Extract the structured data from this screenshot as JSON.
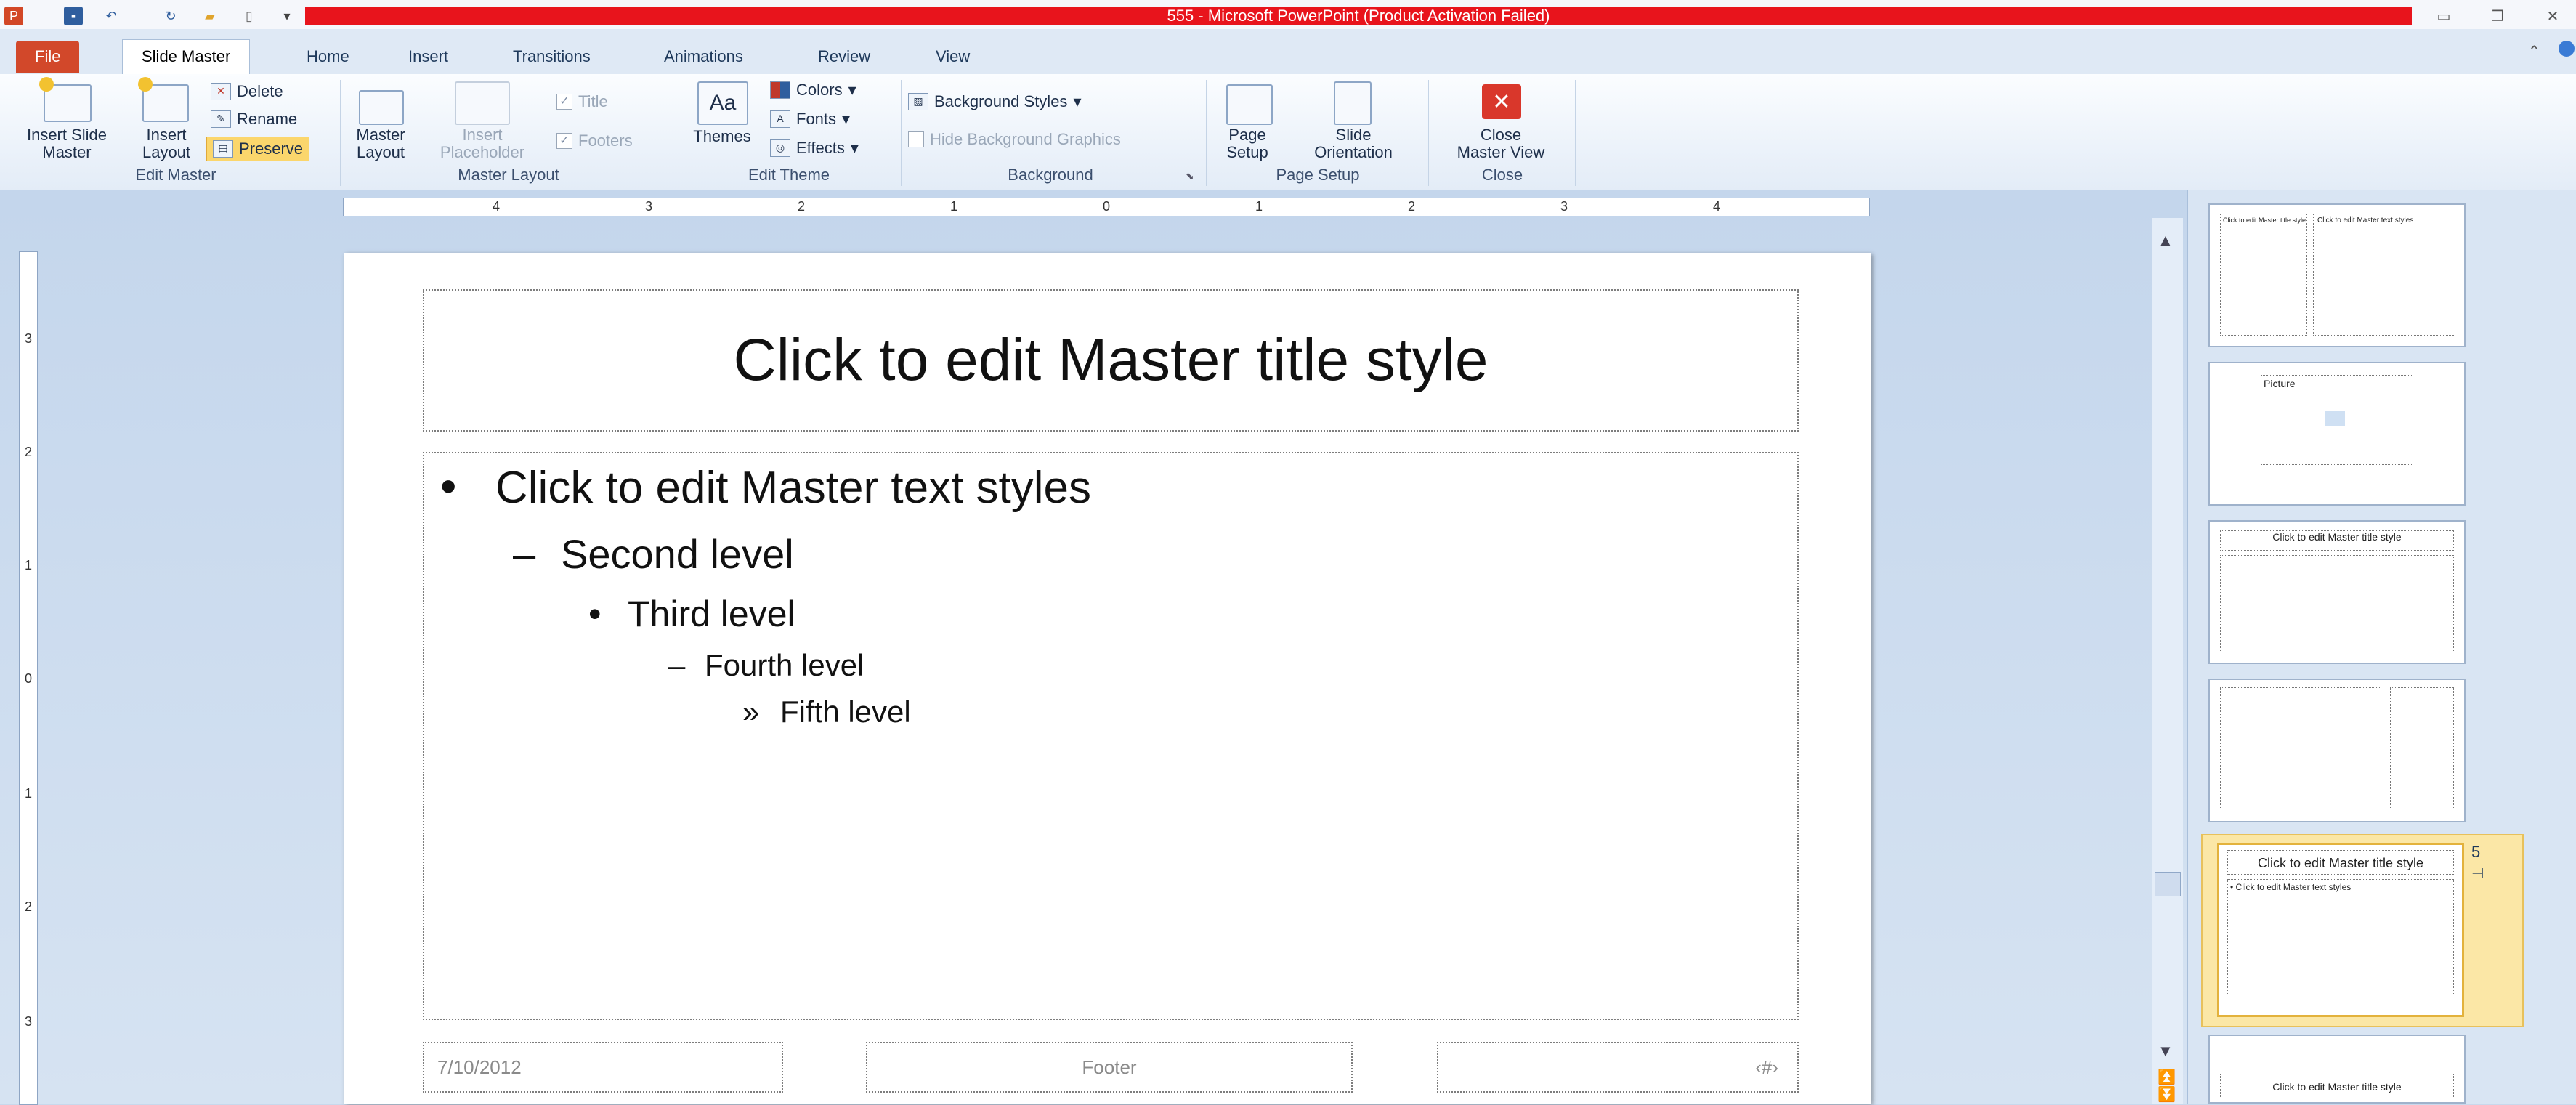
{
  "window": {
    "title": "555  -  Microsoft PowerPoint (Product Activation Failed)"
  },
  "tabs": [
    "File",
    "Slide Master",
    "Home",
    "Insert",
    "Transitions",
    "Animations",
    "Review",
    "View"
  ],
  "ribbon": {
    "edit_master": {
      "label": "Edit Master",
      "insert_slide_master": "Insert Slide\nMaster",
      "insert_layout": "Insert\nLayout",
      "delete": "Delete",
      "rename": "Rename",
      "preserve": "Preserve"
    },
    "master_layout": {
      "label": "Master Layout",
      "master_layout_btn": "Master\nLayout",
      "insert_placeholder": "Insert\nPlaceholder",
      "title_check": "Title",
      "footers_check": "Footers"
    },
    "edit_theme": {
      "label": "Edit Theme",
      "themes": "Themes",
      "colors": "Colors",
      "fonts": "Fonts",
      "effects": "Effects"
    },
    "background": {
      "label": "Background",
      "background_styles": "Background Styles",
      "hide_background_graphics": "Hide Background Graphics"
    },
    "page_setup": {
      "label": "Page Setup",
      "page_setup_btn": "Page\nSetup",
      "slide_orientation": "Slide\nOrientation"
    },
    "close": {
      "label": "Close",
      "close_master_view": "Close\nMaster View"
    }
  },
  "ruler": {
    "horizontal_labels": [
      "4",
      "3",
      "2",
      "1",
      "0",
      "1",
      "2",
      "3",
      "4"
    ],
    "vertical_labels": [
      "3",
      "2",
      "1",
      "0",
      "1",
      "2",
      "3"
    ]
  },
  "slide": {
    "title": "Click to edit Master title style",
    "levels": [
      "Click to edit Master text styles",
      "Second level",
      "Third level",
      "Fourth level",
      "Fifth level"
    ],
    "bullets": [
      "•",
      "–",
      "•",
      "–",
      "»"
    ],
    "footer_date": "7/10/2012",
    "footer_text": "Footer",
    "slide_number": "‹#›"
  },
  "thumbnails": {
    "selected_number": "5",
    "thumb1_left": "Click to edit Master title style",
    "thumb1_right": "Click to edit Master text styles",
    "thumb2_label": "Picture",
    "thumb3_title": "Click to edit Master title style",
    "thumb5_title": "Click to edit Master title style",
    "thumb5_body": "• Click to edit Master text styles",
    "thumb6_title": "Click to edit Master title style"
  }
}
